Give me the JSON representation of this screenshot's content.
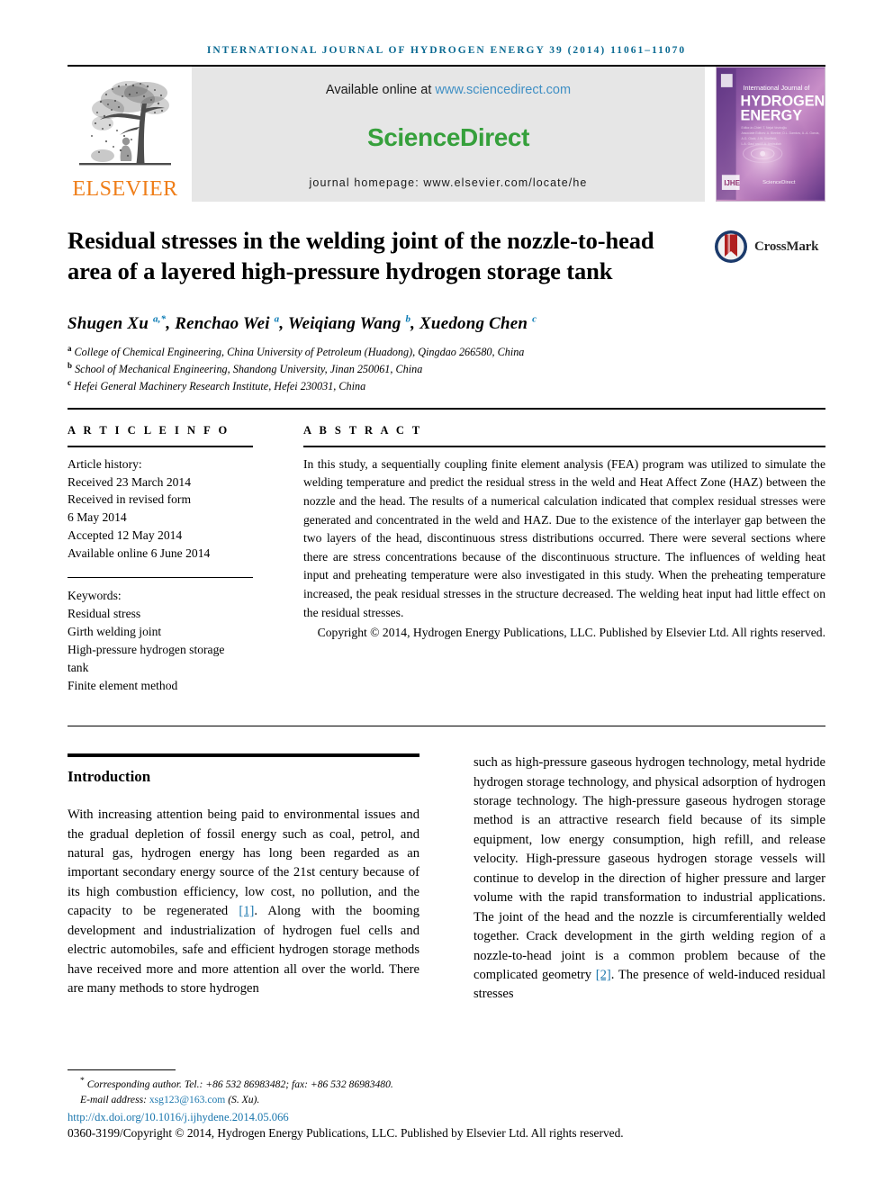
{
  "running_head": "INTERNATIONAL JOURNAL OF HYDROGEN ENERGY 39 (2014) 11061–11070",
  "masthead": {
    "available_prefix": "Available online at ",
    "sciencedirect_url": "www.sciencedirect.com",
    "sciencedirect_logo": "ScienceDirect",
    "homepage": "journal homepage: www.elsevier.com/locate/he",
    "publisher_wordmark": "ELSEVIER",
    "cover": {
      "line1": "International Journal of",
      "line2": "HYDROGEN",
      "line3": "ENERGY",
      "editors_line1": "Editor-in-Chief: T. Nejat Veziroğlu",
      "editors_line2": "Associate Editors: A. Bleeker, D.L. Damkov, A.-A. Garcia,",
      "editors_line3": "A.G. Olabi, J.W. Sheffield,",
      "editors_line4": "L.A. Gaul and E.A. Aminullah",
      "footer_brand": "ScienceDirect",
      "society_mark": "IJHE"
    }
  },
  "article": {
    "title": "Residual stresses in the welding joint of the nozzle-to-head area of a layered high-pressure hydrogen storage tank",
    "crossmark_label": "CrossMark",
    "authors_html": "Shugen Xu <sup>a,*</sup>, Renchao Wei <sup>a</sup>, Weiqiang Wang <sup>b</sup>, Xuedong Chen <sup>c</sup>",
    "affiliations": [
      {
        "marker": "a",
        "text": "College of Chemical Engineering, China University of Petroleum (Huadong), Qingdao 266580, China"
      },
      {
        "marker": "b",
        "text": "School of Mechanical Engineering, Shandong University, Jinan 250061, China"
      },
      {
        "marker": "c",
        "text": "Hefei General Machinery Research Institute, Hefei 230031, China"
      }
    ]
  },
  "article_info": {
    "heading": "A R T I C L E   I N F O",
    "history_label": "Article history:",
    "history": [
      "Received 23 March 2014",
      "Received in revised form",
      "6 May 2014",
      "Accepted 12 May 2014",
      "Available online 6 June 2014"
    ],
    "keywords_label": "Keywords:",
    "keywords": [
      "Residual stress",
      "Girth welding joint",
      "High-pressure hydrogen storage",
      "tank",
      "Finite element method"
    ]
  },
  "abstract": {
    "heading": "A B S T R A C T",
    "text": "In this study, a sequentially coupling finite element analysis (FEA) program was utilized to simulate the welding temperature and predict the residual stress in the weld and Heat Affect Zone (HAZ) between the nozzle and the head. The results of a numerical calculation indicated that complex residual stresses were generated and concentrated in the weld and HAZ. Due to the existence of the interlayer gap between the two layers of the head, discontinuous stress distributions occurred. There were several sections where there are stress concentrations because of the discontinuous structure. The influences of welding heat input and preheating temperature were also investigated in this study. When the preheating temperature increased, the peak residual stresses in the structure decreased. The welding heat input had little effect on the residual stresses.",
    "copyright": "Copyright © 2014, Hydrogen Energy Publications, LLC. Published by Elsevier Ltd. All rights reserved."
  },
  "introduction": {
    "heading": "Introduction",
    "left_paragraph_pre": "With increasing attention being paid to environmental issues and the gradual depletion of fossil energy such as coal, petrol, and natural gas, hydrogen energy has long been regarded as an important secondary energy source of the 21st century because of its high combustion efficiency, low cost, no pollution, and the capacity to be regenerated ",
    "left_ref": "[1]",
    "left_paragraph_post": ". Along with the booming development and industrialization of hydrogen fuel cells and electric automobiles, safe and efficient hydrogen storage methods have received more and more attention all over the world. There are many methods to store hydrogen",
    "right_paragraph_pre": "such as high-pressure gaseous hydrogen technology, metal hydride hydrogen storage technology, and physical adsorption of hydrogen storage technology. The high-pressure gaseous hydrogen storage method is an attractive research field because of its simple equipment, low energy consumption, high refill, and release velocity. High-pressure gaseous hydrogen storage vessels will continue to develop in the direction of higher pressure and larger volume with the rapid transformation to industrial applications. The joint of the head and the nozzle is circumferentially welded together. Crack development in the girth welding region of a nozzle-to-head joint is a common problem because of the complicated geometry ",
    "right_ref": "[2]",
    "right_paragraph_post": ". The presence of weld-induced residual stresses"
  },
  "footnotes": {
    "corresponding_marker": "*",
    "corresponding": "Corresponding author. Tel.: +86 532 86983482; fax: +86 532 86983480.",
    "email_label": "E-mail address: ",
    "email": "xsg123@163.com",
    "email_suffix": " (S. Xu).",
    "doi": "http://dx.doi.org/10.1016/j.ijhydene.2014.05.066",
    "issn_line": "0360-3199/Copyright © 2014, Hydrogen Energy Publications, LLC. Published by Elsevier Ltd. All rights reserved."
  },
  "colors": {
    "running_head": "#0b6a92",
    "sciencedirect_green": "#36a03c",
    "elsevier_orange": "#ef7e19",
    "link_blue": "#1a76ad",
    "band_gray": "#e6e6e6"
  }
}
